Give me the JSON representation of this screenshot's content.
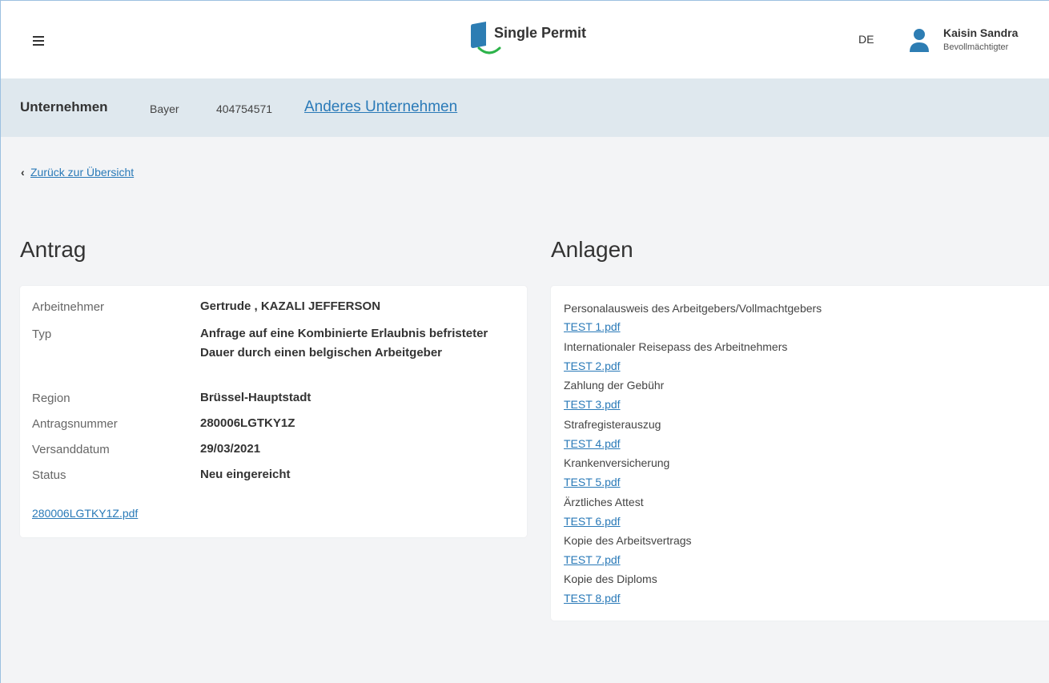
{
  "header": {
    "app_title": "Single Permit",
    "language": "DE",
    "user_name": "Kaisin Sandra",
    "user_role": "Bevollmächtigter"
  },
  "company": {
    "label": "Unternehmen",
    "name": "Bayer",
    "number": "404754571",
    "change_link": "Anderes Unternehmen"
  },
  "back_link": "Zurück zur Übersicht",
  "application": {
    "heading": "Antrag",
    "fields": [
      {
        "label": "Arbeitnehmer",
        "value": "Gertrude , KAZALI JEFFERSON"
      },
      {
        "label": "Typ",
        "value": "Anfrage auf eine Kombinierte Erlaubnis befristeter Dauer durch einen belgischen Arbeitgeber"
      },
      {
        "label": "Region",
        "value": "Brüssel-Hauptstadt"
      },
      {
        "label": "Antragsnummer",
        "value": "280006LGTKY1Z"
      },
      {
        "label": "Versanddatum",
        "value": "29/03/2021"
      },
      {
        "label": "Status",
        "value": "Neu eingereicht"
      }
    ],
    "pdf": "280006LGTKY1Z.pdf"
  },
  "attachments": {
    "heading": "Anlagen",
    "items": [
      {
        "name": "Personalausweis des Arbeitgebers/Vollmachtgebers",
        "file": "TEST 1.pdf"
      },
      {
        "name": "Internationaler Reisepass des Arbeitnehmers",
        "file": "TEST 2.pdf"
      },
      {
        "name": "Zahlung der Gebühr",
        "file": "TEST 3.pdf"
      },
      {
        "name": "Strafregisterauszug",
        "file": "TEST 4.pdf"
      },
      {
        "name": "Krankenversicherung",
        "file": "TEST 5.pdf"
      },
      {
        "name": "Ärztliches Attest",
        "file": "TEST 6.pdf"
      },
      {
        "name": "Kopie des Arbeitsvertrags",
        "file": "TEST 7.pdf"
      },
      {
        "name": "Kopie des Diploms",
        "file": "TEST 8.pdf"
      }
    ]
  },
  "colors": {
    "accent_blue": "#2a7ab8",
    "logo_blue": "#2d7db3",
    "logo_green": "#2db34a",
    "band": "#dfe8ee"
  }
}
